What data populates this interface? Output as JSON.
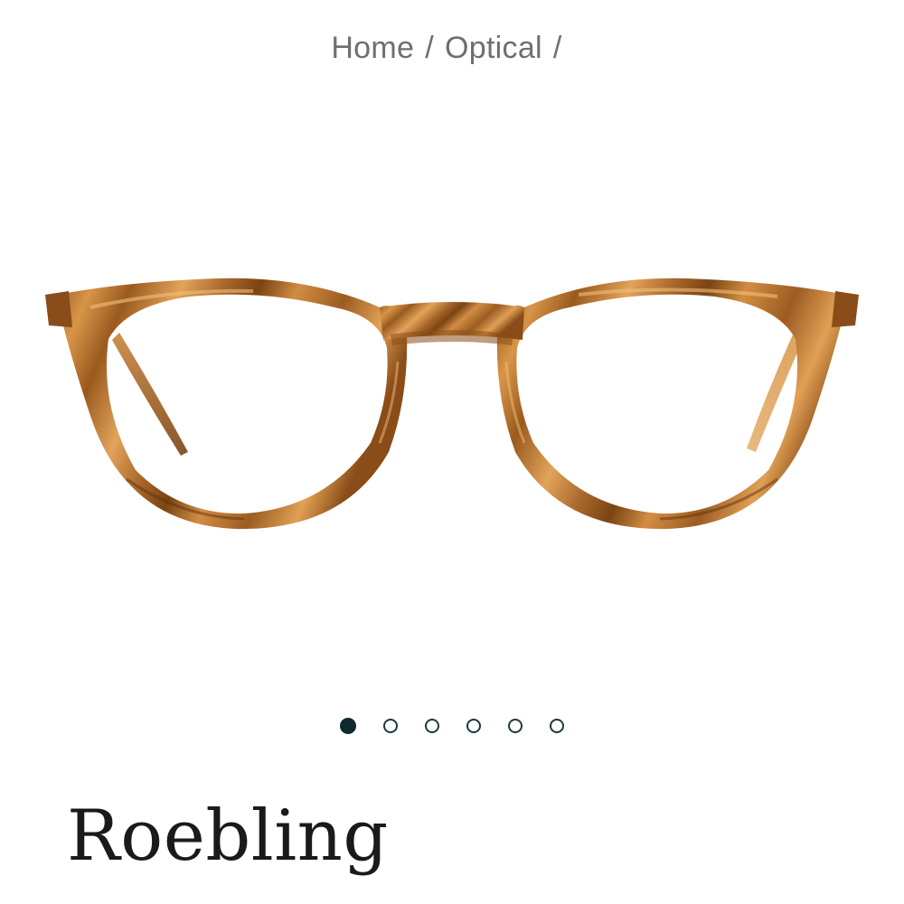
{
  "breadcrumb": {
    "home": "Home",
    "category": "Optical",
    "separator": "/"
  },
  "product": {
    "name": "Roebling",
    "image_icon": "tortoise-eyeglasses-image",
    "frame_color": "#b8732a",
    "frame_dark": "#7a4413",
    "frame_light": "#e3a457"
  },
  "carousel": {
    "total": 6,
    "active_index": 0,
    "active_color": "#0f2a2f"
  }
}
